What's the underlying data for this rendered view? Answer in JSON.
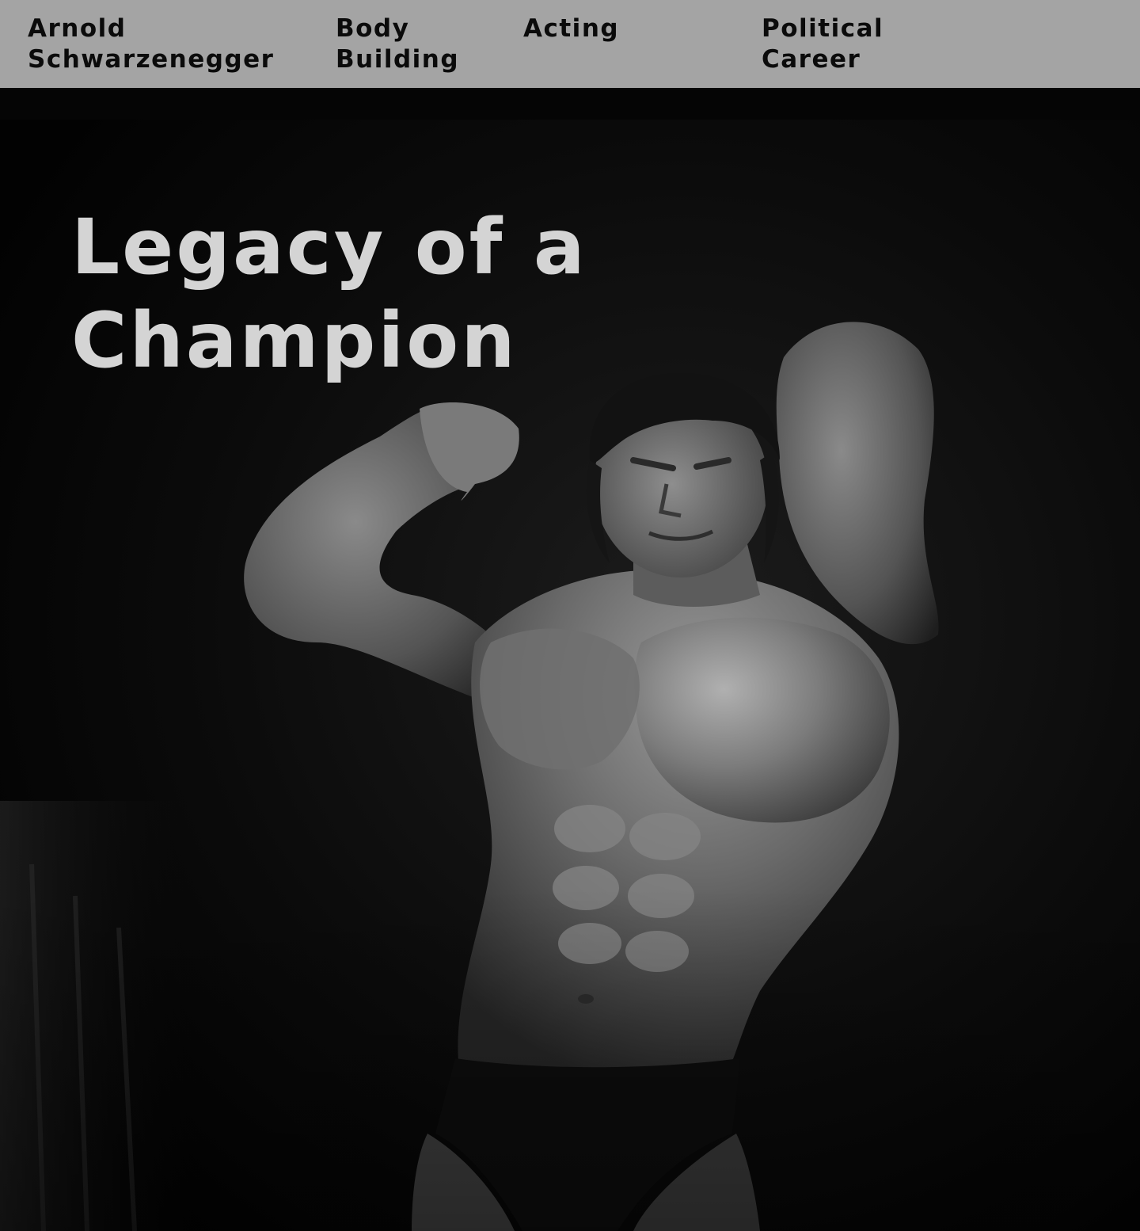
{
  "nav": {
    "home": [
      "Arnold",
      "Schwarzenegger"
    ],
    "items": [
      {
        "lines": [
          "Body",
          "Building"
        ]
      },
      {
        "lines": [
          "Acting"
        ]
      },
      {
        "lines": [
          "Political",
          "Career"
        ]
      }
    ]
  },
  "hero": {
    "title_lines": [
      "Legacy of a",
      "Champion"
    ]
  },
  "colors": {
    "nav_background": "#a4a4a4",
    "nav_text": "#0b0b0b",
    "page_background": "#000000",
    "title_text": "#d4d4d4"
  }
}
